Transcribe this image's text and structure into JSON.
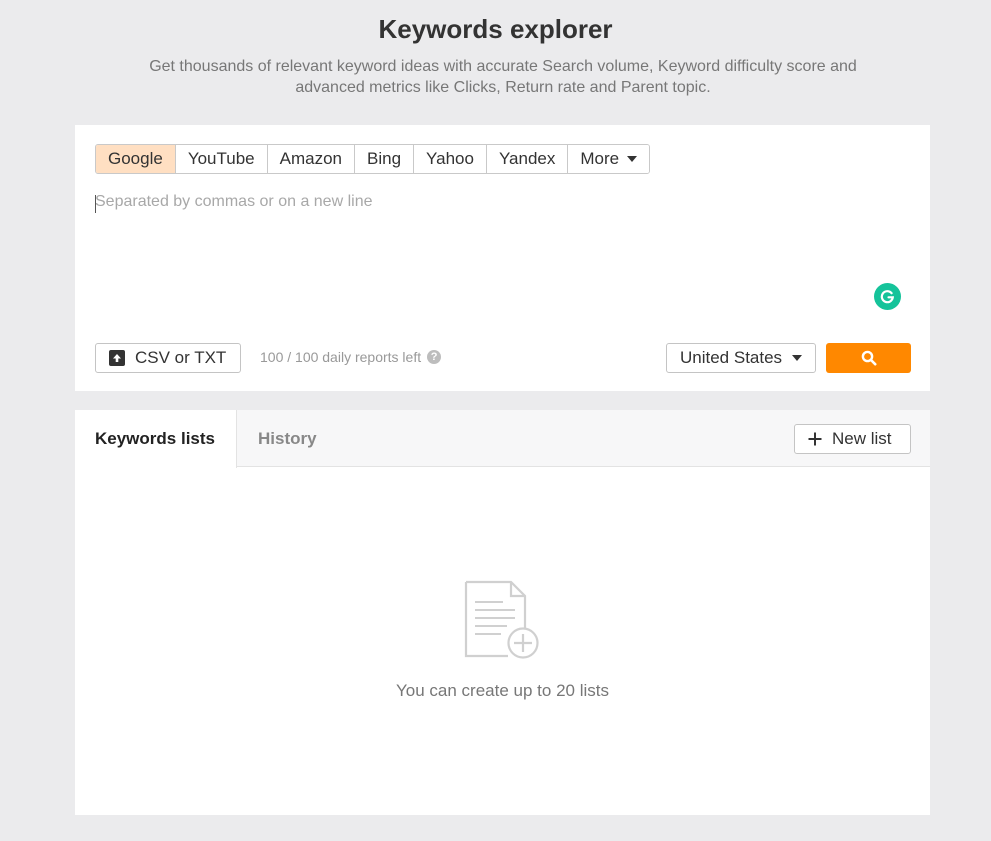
{
  "header": {
    "title": "Keywords explorer",
    "subtitle": "Get thousands of relevant keyword ideas with accurate Search volume, Keyword difficulty score and advanced metrics like Clicks, Return rate and Parent topic."
  },
  "search": {
    "engines": [
      "Google",
      "YouTube",
      "Amazon",
      "Bing",
      "Yahoo",
      "Yandex"
    ],
    "more_label": "More",
    "selected_engine": "Google",
    "placeholder": "Separated by commas or on a new line",
    "value": "",
    "upload_label": "CSV or TXT",
    "reports_left": "100 / 100 daily reports left",
    "country": "United States"
  },
  "lists": {
    "tabs": [
      "Keywords lists",
      "History"
    ],
    "active_tab": "Keywords lists",
    "new_list_label": "New list",
    "empty_message": "You can create up to 20 lists"
  },
  "colors": {
    "accent": "#ff8800",
    "active_tab_bg": "#ffdfc2",
    "grammarly": "#15c39a",
    "page_bg": "#ebebed"
  },
  "icons": [
    "upload-icon",
    "help-icon",
    "search-icon",
    "grammarly-icon",
    "plus-icon",
    "document-add-icon",
    "caret-down-icon"
  ]
}
